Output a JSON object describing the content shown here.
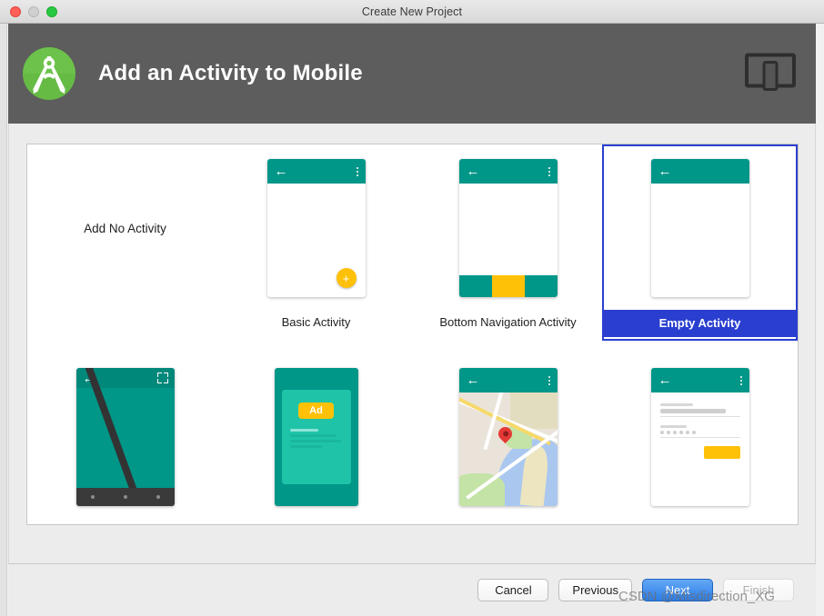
{
  "window": {
    "title": "Create New Project",
    "traffic_lights": [
      "close",
      "minimize",
      "zoom"
    ]
  },
  "header": {
    "title": "Add an Activity to Mobile",
    "logo_icon": "android-studio-logo",
    "device_icon": "tablet-and-phone-icon"
  },
  "templates": {
    "no_activity_label": "Add No Activity",
    "row1": [
      {
        "id": "no-activity",
        "label": "Add No Activity",
        "selected": false,
        "thumb": "none"
      },
      {
        "id": "basic-activity",
        "label": "Basic Activity",
        "selected": false,
        "thumb": "basic"
      },
      {
        "id": "bottom-navigation",
        "label": "Bottom Navigation Activity",
        "selected": false,
        "thumb": "bottomnav"
      },
      {
        "id": "empty-activity",
        "label": "Empty Activity",
        "selected": true,
        "thumb": "empty"
      }
    ],
    "row2": [
      {
        "id": "fullscreen-activity",
        "label": "",
        "selected": false,
        "thumb": "fullscreen"
      },
      {
        "id": "admob-ads-activity",
        "label": "",
        "selected": false,
        "thumb": "admob"
      },
      {
        "id": "google-maps-activity",
        "label": "",
        "selected": false,
        "thumb": "maps"
      },
      {
        "id": "login-activity",
        "label": "",
        "selected": false,
        "thumb": "login"
      }
    ],
    "ad_badge_label": "Ad"
  },
  "footer": {
    "cancel": "Cancel",
    "previous": "Previous",
    "next": "Next",
    "finish": "Finish"
  },
  "watermark": "CSDN @Misdirection_XG",
  "colors": {
    "material_teal": "#009688",
    "material_amber": "#ffc107",
    "selection_blue": "#2a3fd0",
    "primary_button_blue": "#2b7de8",
    "header_gray": "#5d5d5d",
    "logo_green": "#6cc24a"
  }
}
